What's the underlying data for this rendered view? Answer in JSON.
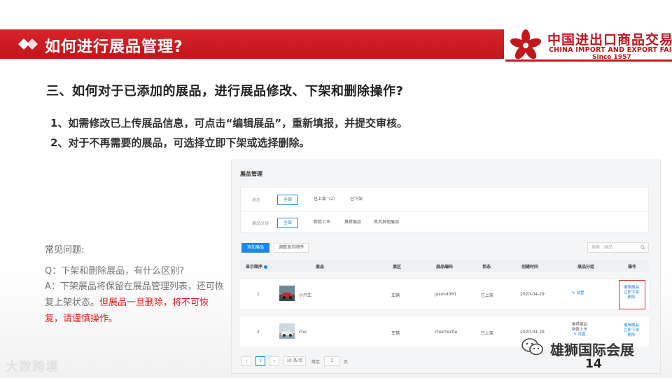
{
  "header": {
    "title": "如何进行展品管理?"
  },
  "logo": {
    "cn": "中国进出口商品交易会",
    "en": "CHINA IMPORT AND EXPORT FAIR",
    "since": "Since 1957"
  },
  "section_title": "三、如何对于已添加的展品，进行展品修改、下架和删除操作?",
  "steps": [
    "1、如需修改已上传展品信息，可点击“编辑展品”，重新填报，并提交审核。",
    "2、对于不再需要的展品，可选择立即下架或选择删除。"
  ],
  "faq": {
    "title": "常见问题:",
    "question": "Q：下架和删除展品，有什么区别?",
    "answer_normal": "A：下架展品将保留在展品管理列表，还可恢复上架状态。",
    "answer_warning": "但展品一旦删除，将不可恢复，请谨慎操作。"
  },
  "panel": {
    "title": "展品管理",
    "status_label": "状态",
    "status_options": [
      "全部",
      "已上架（2）",
      "已下架"
    ],
    "group_label": "展品分组",
    "group_options": [
      "全部",
      "新款上市",
      "推荐展品",
      "首页其他展品"
    ],
    "add_button": "添加展品",
    "order_button": "调整显示顺序",
    "search_placeholder": "搜索：展品",
    "columns": [
      "显示顺序",
      "展品",
      "展区",
      "展品编码",
      "状态",
      "创建时间",
      "展品分组",
      "操作"
    ],
    "rows": [
      {
        "order": "1",
        "name": "小汽车",
        "zone": "车辆",
        "code": "jason4361",
        "status": "已上架",
        "created": "2020-04-29",
        "group_lines": [],
        "group_link": "设置",
        "ops": [
          "编辑展品",
          "立即下架",
          "删除"
        ]
      },
      {
        "order": "2",
        "name": "che",
        "zone": "车辆",
        "code": "checheche",
        "status": "已上架",
        "created": "2020-04-29",
        "group_lines": [
          "推荐展品",
          "新款上市"
        ],
        "group_link": "设置",
        "ops": [
          "编辑展品",
          "立即下架",
          "删除"
        ]
      }
    ],
    "pager": {
      "prev": "‹",
      "current": "1",
      "next": "›",
      "page_size": "10 条/页",
      "goto_label": "跳至",
      "goto_value": "1",
      "page_unit": "页"
    }
  },
  "watermark_left": "大数跨境",
  "watermark_right": "雄狮国际会展",
  "page_number": "14",
  "colors": {
    "brand_red": "#c0161c",
    "accent_blue": "#1e88e5",
    "warning_red": "#e0201c"
  }
}
